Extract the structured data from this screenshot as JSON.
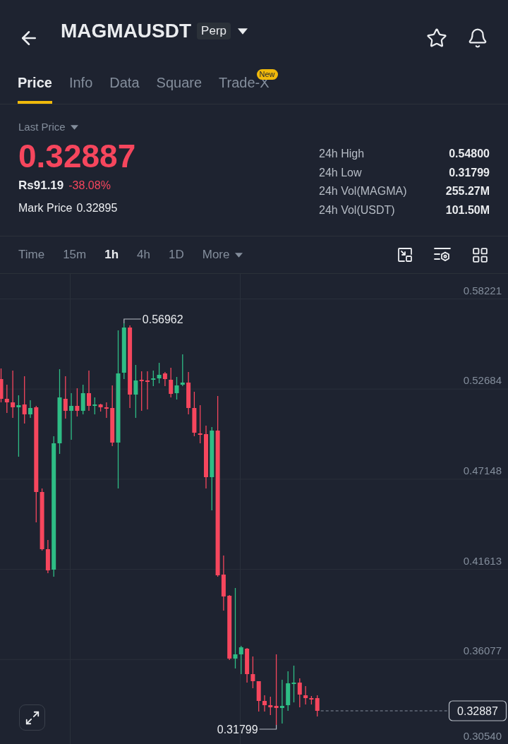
{
  "header": {
    "symbol": "MAGMAUSDT",
    "contract_badge": "Perp"
  },
  "tabs": [
    {
      "label": "Price",
      "selected": true
    },
    {
      "label": "Info",
      "selected": false
    },
    {
      "label": "Data",
      "selected": false
    },
    {
      "label": "Square",
      "selected": false
    },
    {
      "label": "Trade-X",
      "selected": false,
      "badge": "New"
    }
  ],
  "price": {
    "label": "Last Price",
    "last": "0.32887",
    "fiat": "Rs91.19",
    "change": "-38.08%",
    "mark_label": "Mark Price",
    "mark_value": "0.32895"
  },
  "stats": [
    {
      "label": "24h High",
      "value": "0.54800"
    },
    {
      "label": "24h Low",
      "value": "0.31799"
    },
    {
      "label": "24h Vol(MAGMA)",
      "value": "255.27M"
    },
    {
      "label": "24h Vol(USDT)",
      "value": "101.50M"
    }
  ],
  "intervals": [
    {
      "label": "Time",
      "kind": "interval",
      "selected": false
    },
    {
      "label": "15m",
      "kind": "interval",
      "selected": false
    },
    {
      "label": "1h",
      "kind": "interval",
      "selected": true
    },
    {
      "label": "4h",
      "kind": "interval",
      "selected": false
    },
    {
      "label": "1D",
      "kind": "interval",
      "selected": false
    },
    {
      "label": "More",
      "kind": "menu",
      "selected": false
    }
  ],
  "chart": {
    "y_axis_labels": [
      "0.58221",
      "0.52684",
      "0.47148",
      "0.41613",
      "0.36077",
      "0.30540"
    ],
    "high_label": "0.56962",
    "low_label": "0.31799",
    "last_price_tag": "0.32887"
  }
}
